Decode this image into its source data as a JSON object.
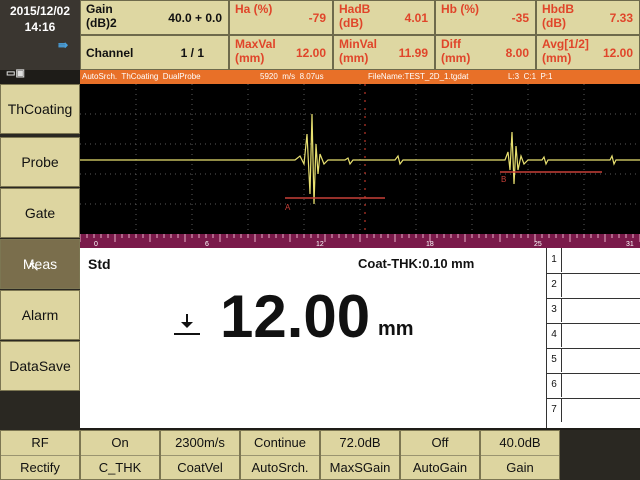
{
  "clock": {
    "date": "2015/12/02",
    "time": "14:16"
  },
  "readouts": {
    "gain": {
      "label": "Gain (dB)2",
      "value": "40.0 + 0.0"
    },
    "channel": {
      "label": "Channel",
      "value": "1 / 1"
    },
    "ha": {
      "label": "Ha (%)",
      "value": "-79"
    },
    "hadb": {
      "label": "HadB (dB)",
      "value": "4.01"
    },
    "hb": {
      "label": "Hb (%)",
      "value": "-35"
    },
    "hbdb": {
      "label": "HbdB (dB)",
      "value": "7.33"
    },
    "maxval": {
      "label": "MaxVal (mm)",
      "value": "12.00"
    },
    "minval": {
      "label": "MinVal (mm)",
      "value": "11.99"
    },
    "diff": {
      "label": "Diff (mm)",
      "value": "8.00"
    },
    "avg": {
      "label": "Avg[1/2] (mm)",
      "value": "12.00"
    }
  },
  "infobar": {
    "mode": "AutoSrch.  ThCoating  DualProbe",
    "velocity": "5920  m/s  8.07us",
    "file": "FileName:TEST_2D_1.tgdat",
    "pos": "L:3  C:1  P:1"
  },
  "menu": [
    "ThCoating",
    "Probe",
    "Gate",
    "Meas",
    "Alarm",
    "DataSave"
  ],
  "scale": [
    "0",
    "6",
    "12",
    "18",
    "25",
    "31"
  ],
  "gates": {
    "a": "A",
    "b": "B"
  },
  "result": {
    "mode": "Std",
    "coating": "Coat-THK:0.10 mm",
    "value": "12.00",
    "unit": "mm",
    "rows": [
      "1",
      "2",
      "3",
      "4",
      "5",
      "6",
      "7"
    ]
  },
  "bottom": [
    {
      "value": "RF",
      "label": "Rectify"
    },
    {
      "value": "On",
      "label": "C_THK"
    },
    {
      "value": "2300m/s",
      "label": "CoatVel"
    },
    {
      "value": "Continue",
      "label": "AutoSrch."
    },
    {
      "value": "72.0dB",
      "label": "MaxSGain"
    },
    {
      "value": "Off",
      "label": "AutoGain"
    },
    {
      "value": "40.0dB",
      "label": "Gain"
    }
  ],
  "colors": {
    "panel": "#ded7a2",
    "accent": "#e0452a",
    "infobar": "#e87028",
    "selected": "#7a6e4c",
    "trace": "#e8e070",
    "gate": "#c84038"
  }
}
